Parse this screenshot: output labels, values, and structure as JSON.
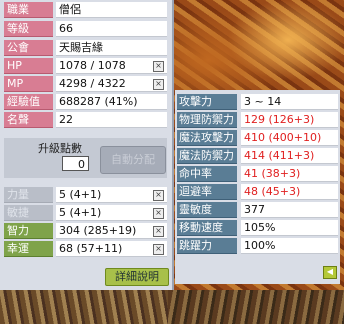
{
  "basic": [
    {
      "label": "職業",
      "value": "僧侶"
    },
    {
      "label": "等級",
      "value": "66"
    },
    {
      "label": "公會",
      "value": "天賜吉緣"
    },
    {
      "label": "HP",
      "value": "1078 / 1078"
    },
    {
      "label": "MP",
      "value": "4298 / 4322"
    },
    {
      "label": "經驗值",
      "value": "688287 (41%)"
    },
    {
      "label": "名聲",
      "value": "22"
    }
  ],
  "ability_points": {
    "title": "升級點數",
    "value": "0",
    "auto_label": "自動分配"
  },
  "stats": [
    {
      "label": "力量",
      "value": "5 (4+1)"
    },
    {
      "label": "敏捷",
      "value": "5 (4+1)"
    },
    {
      "label": "智力",
      "value": "304 (285+19)"
    },
    {
      "label": "幸運",
      "value": "68 (57+11)"
    }
  ],
  "detail_button": "詳細說明",
  "details": [
    {
      "label": "攻擊力",
      "value": "3 ~ 14",
      "highlight": false
    },
    {
      "label": "物理防禦力",
      "value": "129 (126+3)",
      "highlight": true
    },
    {
      "label": "魔法攻擊力",
      "value": "410 (400+10)",
      "highlight": true
    },
    {
      "label": "魔法防禦力",
      "value": "414 (411+3)",
      "highlight": true
    },
    {
      "label": "命中率",
      "value": "41 (38+3)",
      "highlight": true
    },
    {
      "label": "迴避率",
      "value": "48 (45+3)",
      "highlight": true
    },
    {
      "label": "靈敏度",
      "value": "377",
      "highlight": false
    },
    {
      "label": "移動速度",
      "value": "105%",
      "highlight": false
    },
    {
      "label": "跳躍力",
      "value": "100%",
      "highlight": false
    }
  ],
  "icons": {
    "x_button": "x-icon",
    "plus_button": "plus-icon",
    "collapse_button": "arrow-left-icon"
  },
  "colors": {
    "label_pink": "#d87d93",
    "label_green": "#7fa34a",
    "label_blue": "#5a7d95",
    "highlight_red": "#e02020"
  }
}
